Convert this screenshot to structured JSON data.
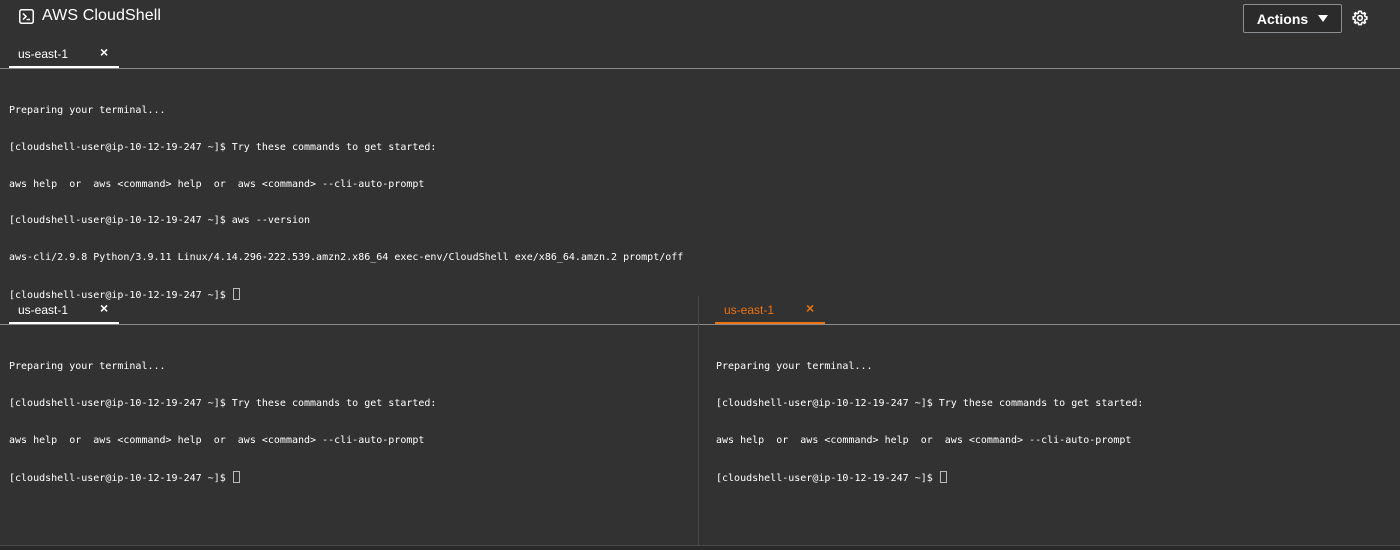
{
  "header": {
    "title": "AWS CloudShell",
    "actions_label": "Actions"
  },
  "top_pane": {
    "tab": {
      "label": "us-east-1",
      "close": "×"
    },
    "lines": [
      "Preparing your terminal...",
      "[cloudshell-user@ip-10-12-19-247 ~]$ Try these commands to get started:",
      "aws help  or  aws <command> help  or  aws <command> --cli-auto-prompt",
      "[cloudshell-user@ip-10-12-19-247 ~]$ aws --version",
      "aws-cli/2.9.8 Python/3.9.11 Linux/4.14.296-222.539.amzn2.x86_64 exec-env/CloudShell exe/x86_64.amzn.2 prompt/off",
      "[cloudshell-user@ip-10-12-19-247 ~]$ "
    ]
  },
  "bottom_left_pane": {
    "tab": {
      "label": "us-east-1",
      "close": "×"
    },
    "lines": [
      "Preparing your terminal...",
      "[cloudshell-user@ip-10-12-19-247 ~]$ Try these commands to get started:",
      "aws help  or  aws <command> help  or  aws <command> --cli-auto-prompt",
      "[cloudshell-user@ip-10-12-19-247 ~]$ "
    ]
  },
  "bottom_right_pane": {
    "tab": {
      "label": "us-east-1",
      "close": "×"
    },
    "lines": [
      "Preparing your terminal...",
      "[cloudshell-user@ip-10-12-19-247 ~]$ Try these commands to get started:",
      "aws help  or  aws <command> help  or  aws <command> --cli-auto-prompt",
      "[cloudshell-user@ip-10-12-19-247 ~]$ "
    ]
  },
  "colors": {
    "background": "#323232",
    "accent": "#ec7211",
    "text": "#ffffff"
  },
  "icons": {
    "brand": "terminal-prompt-icon",
    "actions_caret": "caret-down-icon",
    "settings": "gear-icon",
    "tab_close": "close-icon"
  }
}
